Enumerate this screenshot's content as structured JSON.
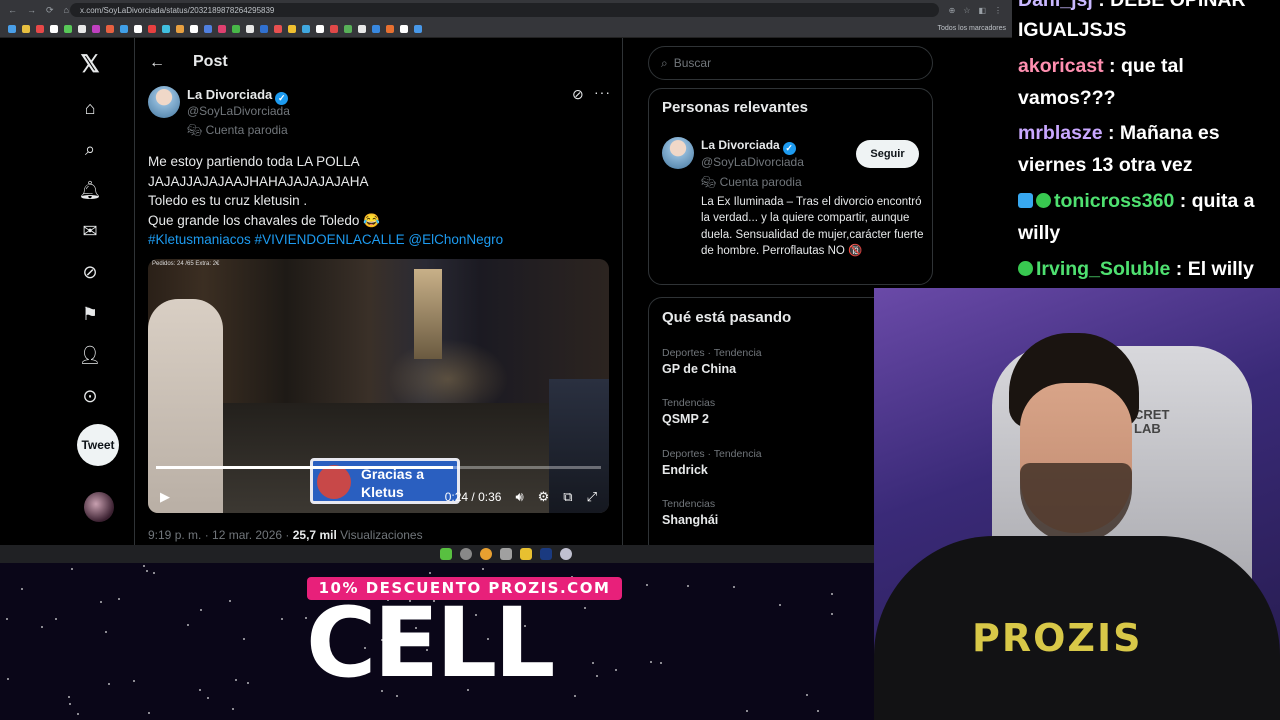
{
  "browser": {
    "url": "x.com/SoyLaDivorciada/status/2032189878264295839",
    "bookmarks_label": "Todos los marcadores"
  },
  "nav": {
    "tweet_button": "Tweet"
  },
  "post": {
    "header_title": "Post",
    "author_name": "La Divorciada",
    "author_handle": "@SoyLaDivorciada",
    "parody_label": "Cuenta parodia",
    "lines": [
      "Me estoy partiendo toda LA POLLA",
      "JAJAJJAJAJAAJHAHAJAJAJAJAHA",
      "Toledo es tu cruz kletusin .",
      "Que grande los chavales de Toledo 😂"
    ],
    "tags": "#Kletusmaniacos #VIVIENDOENLACALLE @ElChonNegro",
    "video": {
      "overlay_stats": "Pedidos: 24 /65   Extra: 2€",
      "badge_line1": "Gracias a",
      "badge_line2": "Kletus",
      "time": "0:24 / 0:36",
      "progress": 0.667
    },
    "meta_time": "9:19 p. m. · 12 mar. 2026 · ",
    "meta_views_count": "25,7 mil",
    "meta_views_label": " Visualizaciones"
  },
  "search": {
    "placeholder": "Buscar"
  },
  "relevant": {
    "title": "Personas relevantes",
    "name": "La Divorciada",
    "handle": "@SoyLaDivorciada",
    "parody_label": "Cuenta parodia",
    "follow_label": "Seguir",
    "bio": "La Ex Iluminada – Tras el divorcio encontró la verdad... y la quiere compartir, aunque duela. Sensualidad de mujer,carácter fuerte de hombre. Perroflautas NO 🔞"
  },
  "trends": {
    "title": "Qué está pasando",
    "items": [
      {
        "category": "Deportes · Tendencia",
        "name": "GP de China"
      },
      {
        "category": "Tendencias",
        "name": "QSMP 2"
      },
      {
        "category": "Deportes · Tendencia",
        "name": "Endrick"
      },
      {
        "category": "Tendencias",
        "name": "Shanghái"
      }
    ]
  },
  "chat": {
    "messages": [
      {
        "user": "Dani_jsj",
        "text": " : DEBE OPINAR",
        "color": "#c9b8ff"
      },
      {
        "user": "",
        "text": "IGUALJSJS",
        "color": "#ffffff"
      },
      {
        "user": "akoricast",
        "text": " : que tal",
        "color": "#ff8fb0"
      },
      {
        "user": "",
        "text": "vamos???",
        "color": "#ffffff"
      },
      {
        "user": "mrblasze",
        "text": " : Mañana es",
        "color": "#c9a8ff"
      },
      {
        "user": "",
        "text": "viernes 13 otra vez",
        "color": "#ffffff"
      },
      {
        "user": "tonicross360",
        "text": " : quita a",
        "color": "#4fe070"
      },
      {
        "user": "",
        "text": "willy",
        "color": "#ffffff"
      },
      {
        "user": "Irving_Soluble",
        "text": " : El willy",
        "color": "#4fe070"
      }
    ]
  },
  "promo": {
    "discount": "10% DESCUENTO PROZIS.COM",
    "code": "CELL"
  },
  "webcam": {
    "shirt_logo": "PROZIS",
    "chair_logo_1": "CRET",
    "chair_logo_2": "LAB"
  },
  "colors": {
    "accent": "#1d9bf0",
    "promo_pink": "#e8207a"
  }
}
